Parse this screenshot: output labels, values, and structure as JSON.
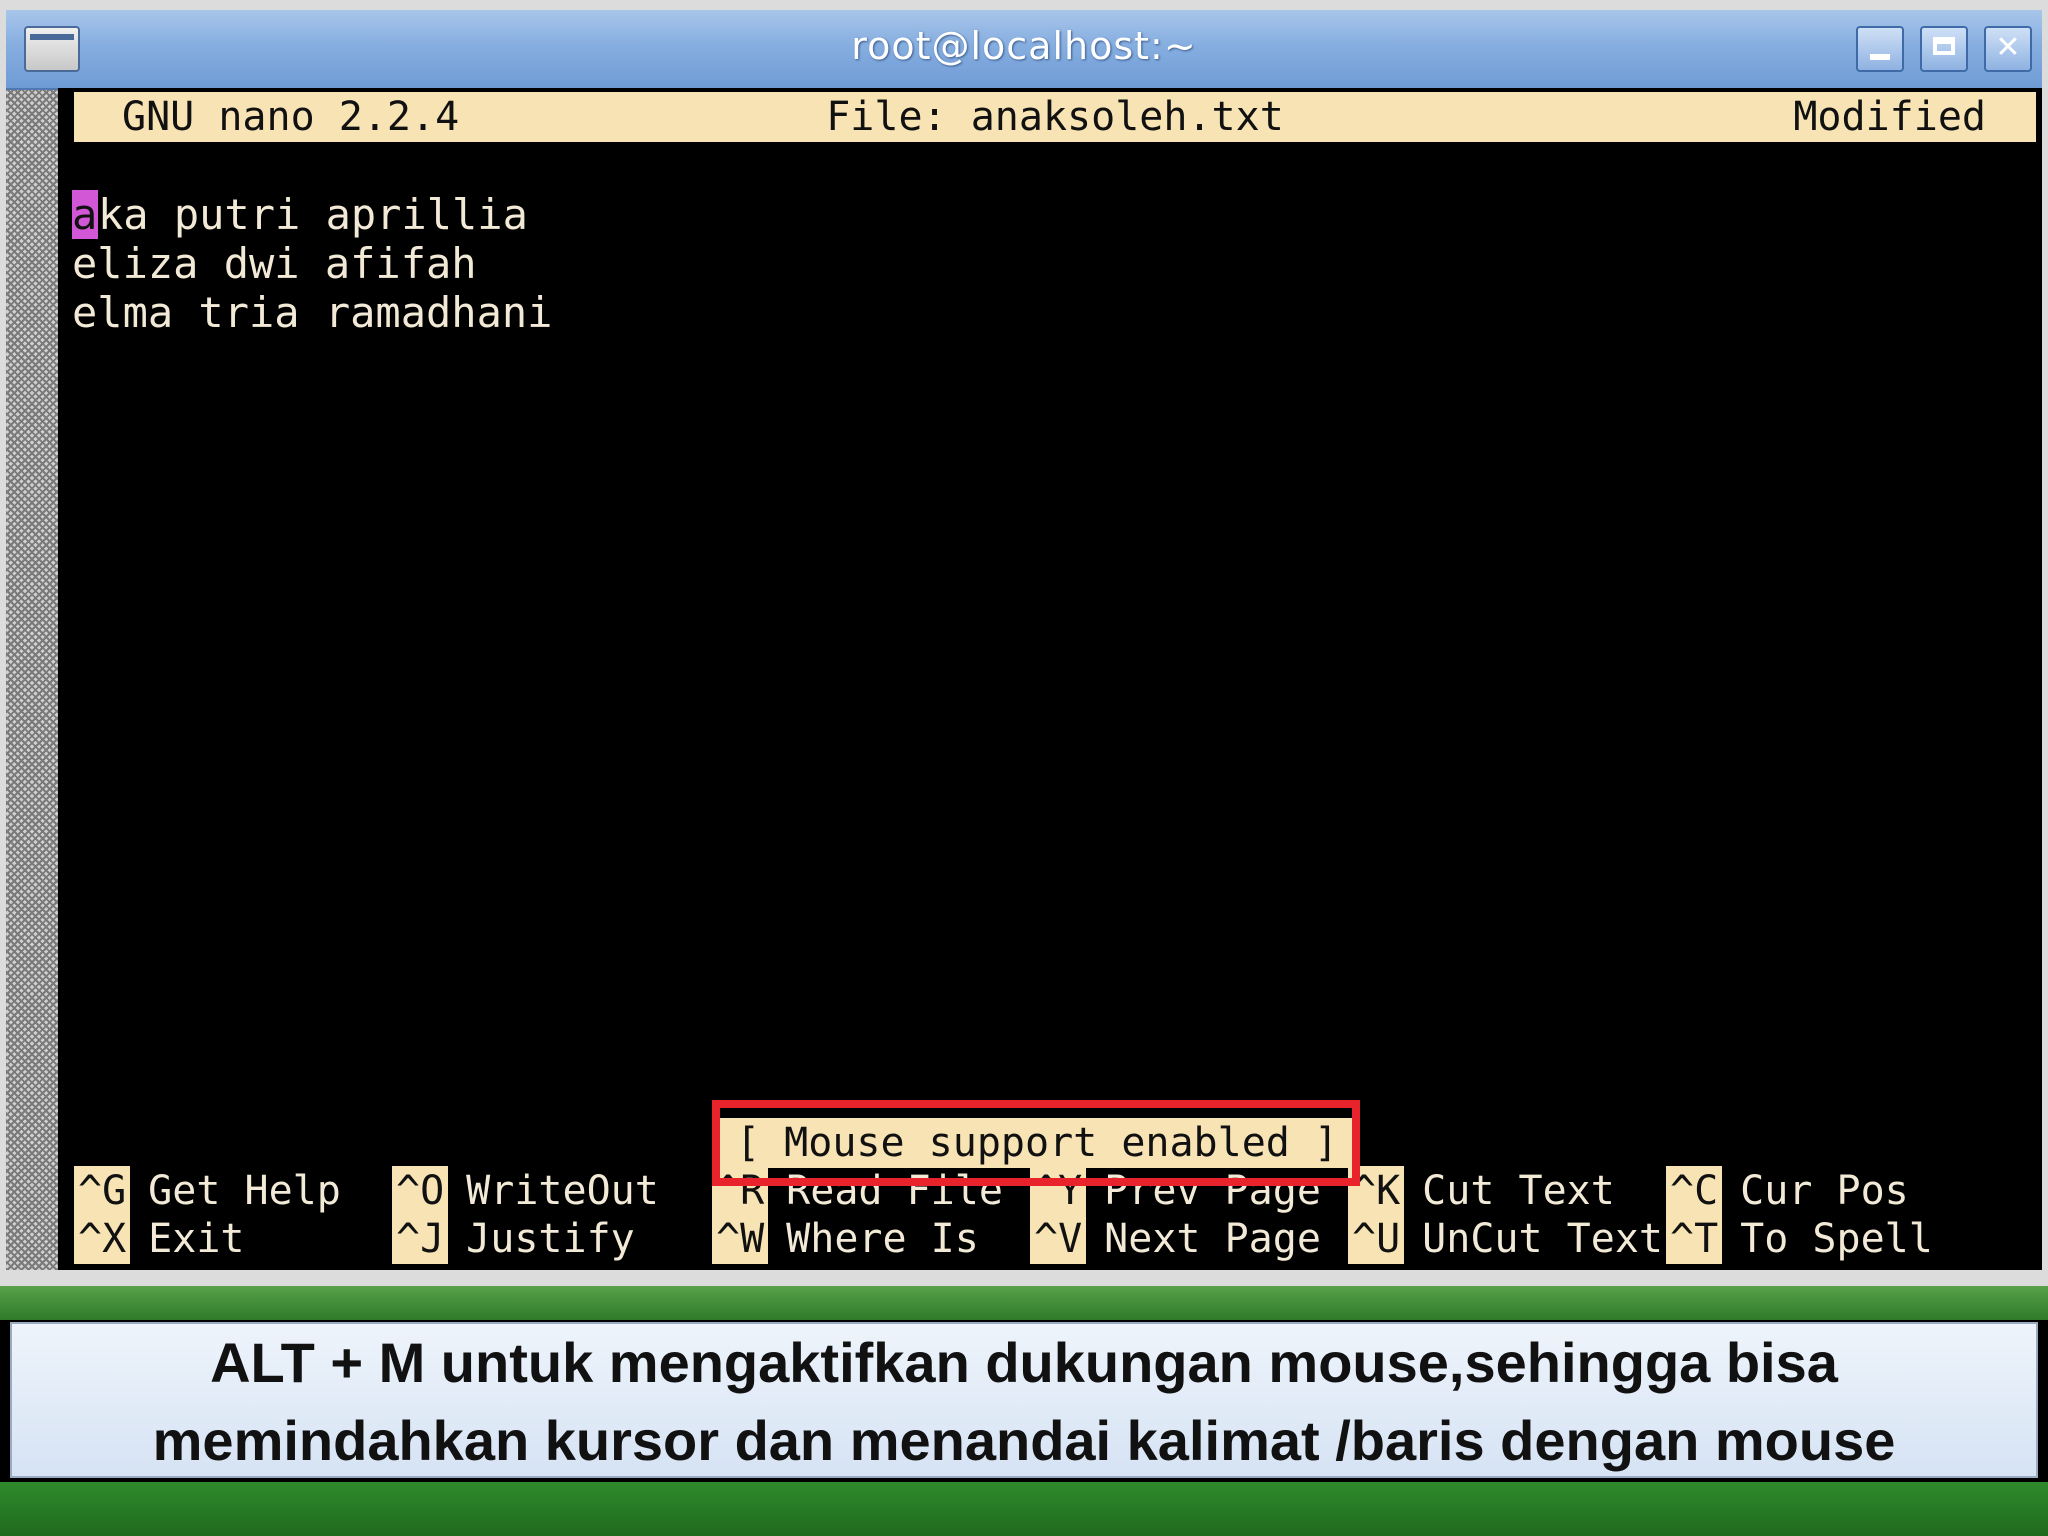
{
  "window": {
    "title": "root@localhost:~",
    "buttons": [
      "minimize-icon",
      "maximize-icon",
      "close-icon"
    ]
  },
  "nano": {
    "version": "GNU nano 2.2.4",
    "filename": "File: anaksoleh.txt",
    "status": "Modified",
    "lines": [
      "aka putri aprillia",
      "eliza dwi afifah",
      "elma tria ramadhani"
    ],
    "cursor_char": "a",
    "status_message": "[ Mouse support enabled ]",
    "shortcuts": {
      "row1": [
        {
          "key": "^G",
          "label": "Get Help"
        },
        {
          "key": "^O",
          "label": "WriteOut"
        },
        {
          "key": "^R",
          "label": "Read File"
        },
        {
          "key": "^Y",
          "label": "Prev Page"
        },
        {
          "key": "^K",
          "label": "Cut Text"
        },
        {
          "key": "^C",
          "label": "Cur Pos"
        }
      ],
      "row2": [
        {
          "key": "^X",
          "label": "Exit"
        },
        {
          "key": "^J",
          "label": "Justify"
        },
        {
          "key": "^W",
          "label": "Where Is"
        },
        {
          "key": "^V",
          "label": "Next Page"
        },
        {
          "key": "^U",
          "label": "UnCut Text"
        },
        {
          "key": "^T",
          "label": "To Spell"
        }
      ]
    }
  },
  "caption": {
    "line1": "ALT + M untuk mengaktifkan dukungan mouse,sehingga bisa",
    "line2": "memindahkan kursor dan menandai kalimat /baris dengan mouse"
  },
  "colors": {
    "terminal_bg": "#000000",
    "header_bg": "#f7e3b4",
    "cursor": "#d257d6",
    "highlight": "#e8232b",
    "slide_green": "#2d7a2a"
  }
}
